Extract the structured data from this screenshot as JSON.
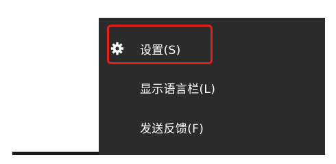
{
  "menu": {
    "items": [
      {
        "label": "设置(S)",
        "icon": "gear-icon",
        "highlighted": true
      },
      {
        "label": "显示语言栏(L)",
        "icon": "",
        "highlighted": false
      },
      {
        "label": "发送反馈(F)",
        "icon": "",
        "highlighted": false
      }
    ],
    "background_color": "#2b2b2b",
    "text_color": "#ffffff",
    "highlight_color": "#e0221b"
  }
}
